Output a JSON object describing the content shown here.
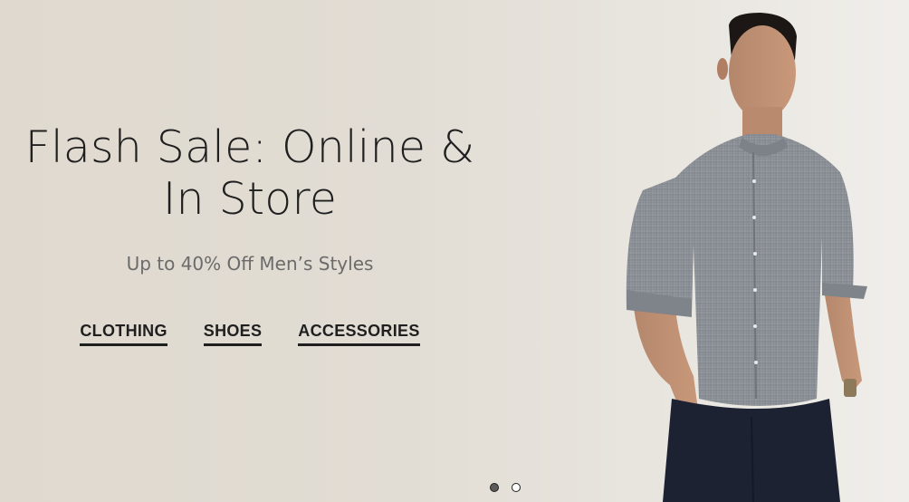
{
  "hero": {
    "headline_line1": "Flash Sale: Online &",
    "headline_line2": "In Store",
    "subhead": "Up to 40% Off Men’s Styles",
    "links": [
      {
        "label": "CLOTHING"
      },
      {
        "label": "SHOES"
      },
      {
        "label": "ACCESSORIES"
      }
    ]
  },
  "carousel": {
    "slides": 2,
    "active_index": 0
  },
  "colors": {
    "background": "#e2ddd4",
    "text": "#1f1f1f",
    "subtext": "#6b6b6b"
  }
}
